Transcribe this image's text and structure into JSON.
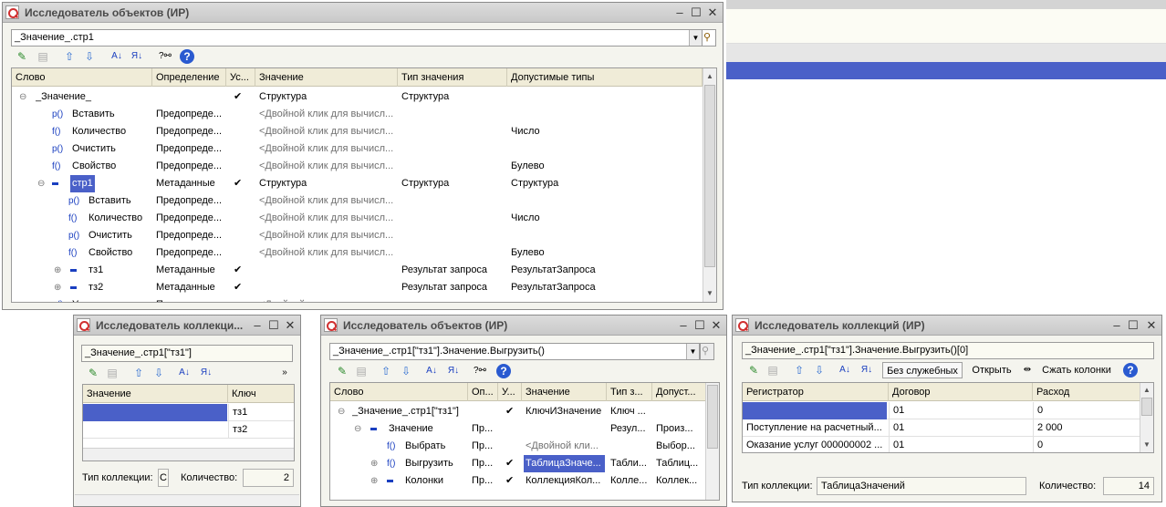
{
  "w1": {
    "title": "Исследователь объектов (ИР)",
    "expr": "_Значение_.стр1",
    "headers": [
      "Слово",
      "Определение",
      "Ус...",
      "Значение",
      "Тип значения",
      "Допустимые типы"
    ],
    "rows": [
      {
        "pre": "⊖",
        "icon": "",
        "word": "_Значение_",
        "def": "",
        "use": "✔",
        "val": "Структура",
        "type": "Структура",
        "allow": ""
      },
      {
        "pre": "",
        "icon": "p()",
        "word": "Вставить",
        "def": "Предопреде...",
        "use": "",
        "val": "<Двойной клик для вычисл...",
        "type": "",
        "allow": ""
      },
      {
        "pre": "",
        "icon": "f()",
        "word": "Количество",
        "def": "Предопреде...",
        "use": "",
        "val": "<Двойной клик для вычисл...",
        "type": "",
        "allow": "Число"
      },
      {
        "pre": "",
        "icon": "p()",
        "word": "Очистить",
        "def": "Предопреде...",
        "use": "",
        "val": "<Двойной клик для вычисл...",
        "type": "",
        "allow": ""
      },
      {
        "pre": "",
        "icon": "f()",
        "word": "Свойство",
        "def": "Предопреде...",
        "use": "",
        "val": "<Двойной клик для вычисл...",
        "type": "",
        "allow": "Булево"
      },
      {
        "pre": "⊖",
        "icon": "dash",
        "word": "стр1",
        "def": "Метаданные",
        "use": "✔",
        "val": "Структура",
        "type": "Структура",
        "allow": "Структура"
      },
      {
        "pre": "",
        "icon": "p()",
        "word": "Вставить",
        "def": "Предопреде...",
        "use": "",
        "val": "<Двойной клик для вычисл...",
        "type": "",
        "allow": ""
      },
      {
        "pre": "",
        "icon": "f()",
        "word": "Количество",
        "def": "Предопреде...",
        "use": "",
        "val": "<Двойной клик для вычисл...",
        "type": "",
        "allow": "Число"
      },
      {
        "pre": "",
        "icon": "p()",
        "word": "Очистить",
        "def": "Предопреде...",
        "use": "",
        "val": "<Двойной клик для вычисл...",
        "type": "",
        "allow": ""
      },
      {
        "pre": "",
        "icon": "f()",
        "word": "Свойство",
        "def": "Предопреде...",
        "use": "",
        "val": "<Двойной клик для вычисл...",
        "type": "",
        "allow": "Булево"
      },
      {
        "pre": "⊕",
        "icon": "dash",
        "word": "тз1",
        "def": "Метаданные",
        "use": "✔",
        "val": "",
        "type": "Результат запроса",
        "allow": "РезультатЗапроса"
      },
      {
        "pre": "⊕",
        "icon": "dash",
        "word": "тз2",
        "def": "Метаданные",
        "use": "✔",
        "val": "",
        "type": "Результат запроса",
        "allow": "РезультатЗапроса"
      },
      {
        "pre": "",
        "icon": "p()",
        "word": "У...",
        "def": "П...",
        "use": "",
        "val": "<Двойной",
        "type": "",
        "allow": ""
      }
    ]
  },
  "w2": {
    "title": "Исследователь коллекци...",
    "expr": "_Значение_.стр1[\"тз1\"]",
    "headers": [
      "Значение",
      "Ключ"
    ],
    "rows": [
      {
        "val": "",
        "key": "тз1"
      },
      {
        "val": "",
        "key": "тз2"
      }
    ],
    "type_label": "Тип коллекции:",
    "type_value": "С",
    "count_label": "Количество:",
    "count": "2"
  },
  "w3": {
    "title": "Исследователь объектов (ИР)",
    "expr": "_Значение_.стр1[\"тз1\"].Значение.Выгрузить()",
    "headers": [
      "Слово",
      "Оп...",
      "У...",
      "Значение",
      "Тип з...",
      "Допуст..."
    ],
    "rows": [
      {
        "pre": "⊖",
        "icon": "",
        "word": "_Значение_.стр1[\"тз1\"]",
        "def": "",
        "use": "✔",
        "val": "КлючИЗначение",
        "type": "Ключ ...",
        "allow": ""
      },
      {
        "pre": "⊖",
        "icon": "dash",
        "word": "Значение",
        "def": "Пр...",
        "use": "",
        "val": "",
        "type": "Резул...",
        "allow": "Произ..."
      },
      {
        "pre": "",
        "icon": "f()",
        "word": "Выбрать",
        "def": "Пр...",
        "use": "",
        "val": "<Двойной кли...",
        "type": "",
        "allow": "Выбор..."
      },
      {
        "pre": "⊕",
        "icon": "f()",
        "word": "Выгрузить",
        "def": "Пр...",
        "use": "✔",
        "val": "ТаблицаЗначе...",
        "type": "Табли...",
        "allow": "Таблиц..."
      },
      {
        "pre": "⊕",
        "icon": "dash",
        "word": "Колонки",
        "def": "Пр...",
        "use": "✔",
        "val": "КоллекцияКол...",
        "type": "Колле...",
        "allow": "Коллек..."
      }
    ]
  },
  "w4": {
    "title": "Исследователь коллекций (ИР)",
    "expr": "_Значение_.стр1[\"тз1\"].Значение.Выгрузить()[0]",
    "btn_noservice": "Без служебных",
    "btn_open": "Открыть",
    "btn_shrink": "Сжать колонки",
    "headers": [
      "Регистратор",
      "Договор",
      "Расход"
    ],
    "rows": [
      {
        "reg": "",
        "dog": "01",
        "exp": "0"
      },
      {
        "reg": "Поступление на расчетный...",
        "dog": "01",
        "exp": "2 000"
      },
      {
        "reg": "Оказание услуг 000000002 ...",
        "dog": "01",
        "exp": "0"
      }
    ],
    "type_label": "Тип коллекции:",
    "type_value": "ТаблицаЗначений",
    "count_label": "Количество:",
    "count": "14"
  },
  "colors": {
    "selection": "#4a60c8",
    "header": "#f0ecd8",
    "window": "#f4f4ee"
  }
}
